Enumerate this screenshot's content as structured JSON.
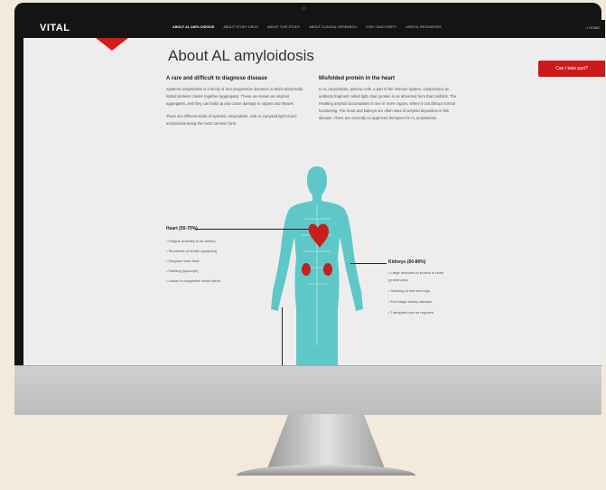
{
  "app": {
    "logo": "VITAL"
  },
  "nav": {
    "items": [
      {
        "label": "ABOUT AL AMYLOIDOSIS",
        "active": true
      },
      {
        "label": "ABOUT STUDY DRUG",
        "active": false
      },
      {
        "label": "ABOUT THIS STUDY",
        "active": false
      },
      {
        "label": "ABOUT CLINICAL RESEARCH",
        "active": false
      },
      {
        "label": "COM / DIAG PARTY",
        "active": false
      },
      {
        "label": "USEFUL RESOURCES",
        "active": false
      }
    ],
    "home_label": "HOME"
  },
  "cta": {
    "label": "Can I take part?"
  },
  "page": {
    "title": "About AL amyloidosis",
    "left": {
      "heading": "A rare and difficult to diagnose disease",
      "paragraphs": [
        "Systemic amyloidosis is a family of rare progressive diseases in which abnormally folded proteins cluster together (aggregate). These are known as amyloid aggregates, and they can build up and cause damage in organs and tissues.",
        "There are different kinds of systemic amyloidosis, with AL (amyloid light chain) amyloidosis being the most common form."
      ]
    },
    "right": {
      "heading": "Misfolded protein in the heart",
      "paragraphs": [
        "In AL amyloidosis, plasma cells, a part of the immune system, overproduce an antibody fragment called light chain protein in an abnormal form that misfolds. The resulting amyloid accumulates in one or more organs, where it can disrupt normal functioning. The heart and kidneys are often sites of amyloid deposition in this disease. There are currently no approved therapies for AL amyloidosis."
      ]
    },
    "heart": {
      "title": "Heart (50-70%)",
      "items": [
        "Fatigue (inability to be active)",
        "Shortness of breath (dyspnea)",
        "Irregular heart beat",
        "Fainting (syncope)",
        "Leads to congestive heart failure"
      ]
    },
    "kidneys": {
      "title": "Kidneys (60-80%)",
      "items": [
        "Large amounts of protein in urine (proteinuria)",
        "Swelling of feet and legs",
        "End stage kidney disease",
        "Transplant can be required"
      ]
    }
  },
  "colors": {
    "accent": "#cc1a1a",
    "figure": "#5ec8c8",
    "navbar": "#141414"
  }
}
